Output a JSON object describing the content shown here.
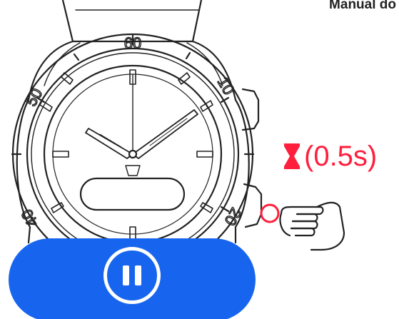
{
  "header": {
    "title": "Manual do"
  },
  "watch": {
    "bezel_numbers": [
      "60",
      "10",
      "20",
      "40",
      "50"
    ]
  },
  "button_hint": {
    "duration": "(0.5s)",
    "hourglass_icon": "hourglass-icon",
    "accent_color": "#ff1f3d"
  },
  "player": {
    "pause_icon": "pause-icon",
    "accent_color": "#1765ef"
  }
}
